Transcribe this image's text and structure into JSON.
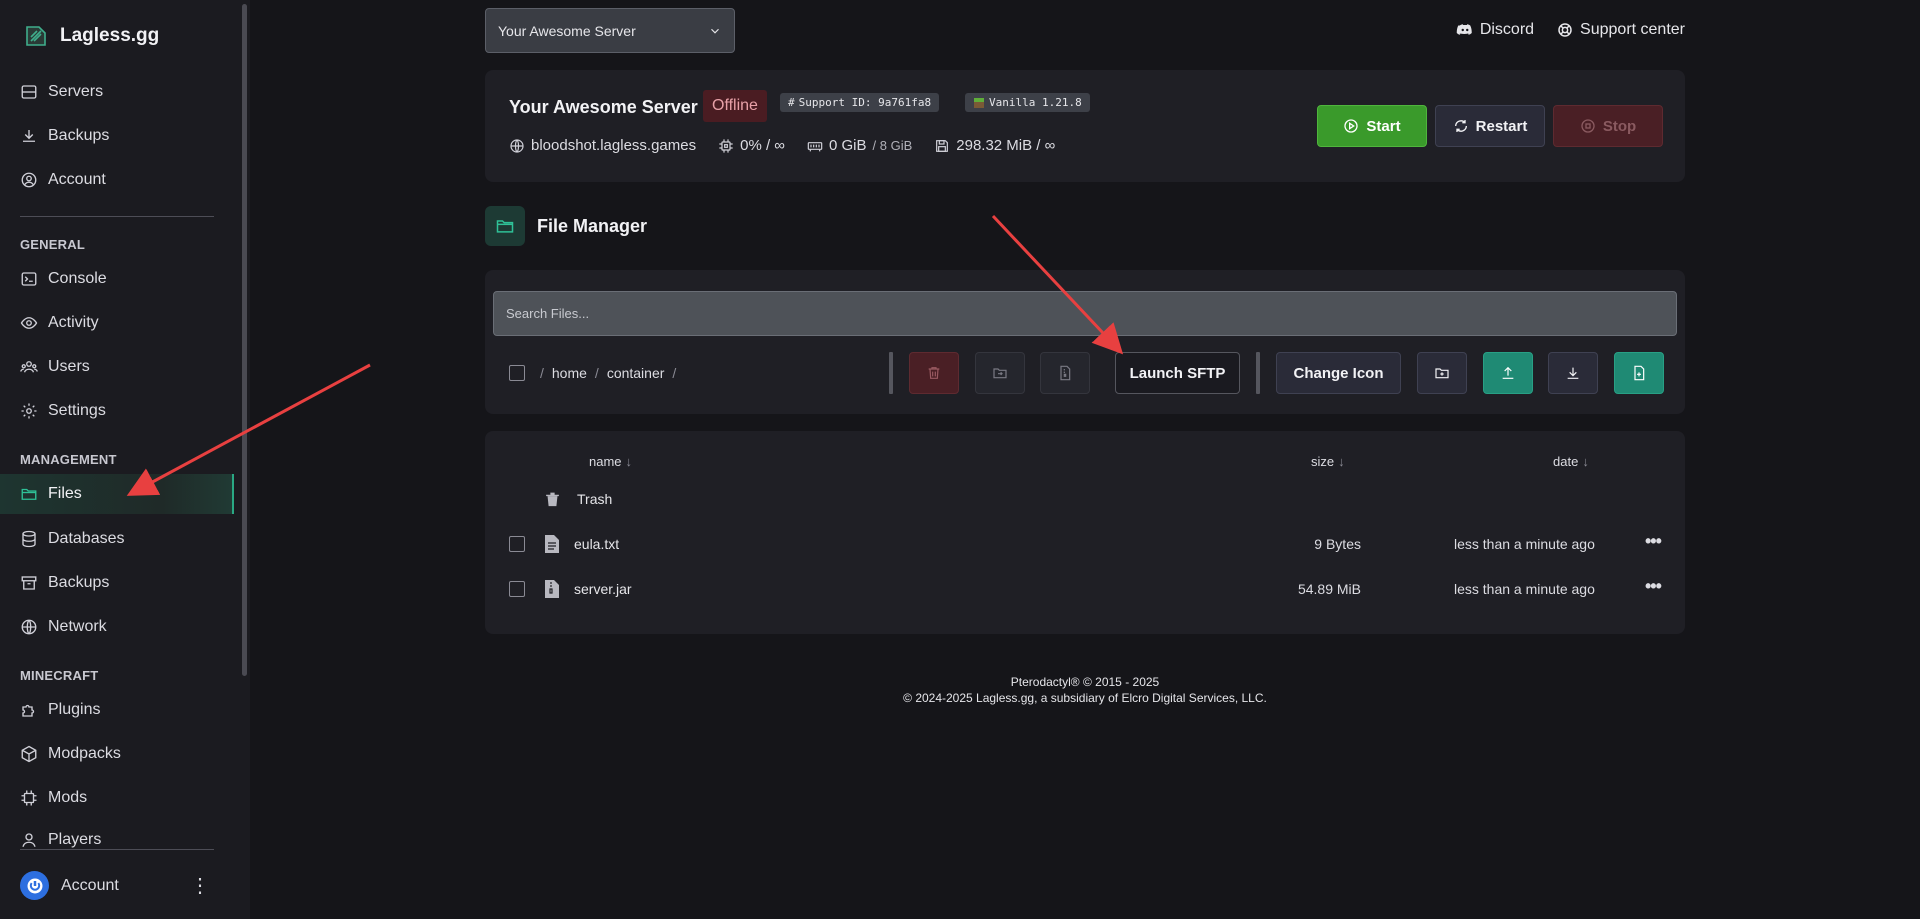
{
  "brand": {
    "name": "Lagless.gg"
  },
  "sidebar": {
    "top_items": [
      {
        "label": "Servers",
        "icon": "server-icon"
      },
      {
        "label": "Backups",
        "icon": "download-icon"
      },
      {
        "label": "Account",
        "icon": "user-circle-icon"
      }
    ],
    "sections": [
      {
        "title": "GENERAL",
        "items": [
          "Console",
          "Activity",
          "Users",
          "Settings"
        ]
      },
      {
        "title": "MANAGEMENT",
        "items": [
          "Files",
          "Databases",
          "Backups",
          "Network"
        ]
      },
      {
        "title": "MINECRAFT",
        "items": [
          "Plugins",
          "Modpacks",
          "Mods",
          "Players"
        ]
      }
    ],
    "active_item": "Files",
    "account_label": "Account"
  },
  "server_select": {
    "value": "Your Awesome Server"
  },
  "top_links": {
    "discord": "Discord",
    "support": "Support center"
  },
  "server": {
    "name": "Your Awesome Server",
    "status": "Offline",
    "support_id": "Support ID: 9a761fa8",
    "version": "Vanilla 1.21.8",
    "address": "bloodshot.lagless.games",
    "cpu": "0% / ∞",
    "memory_used": "0 GiB",
    "memory_limit": "/ 8 GiB",
    "disk": "298.32 MiB / ∞",
    "buttons": {
      "start": "Start",
      "restart": "Restart",
      "stop": "Stop"
    }
  },
  "file_manager": {
    "title": "File Manager",
    "search_placeholder": "Search Files...",
    "breadcrumb": [
      "/",
      "home",
      "/",
      "container",
      "/"
    ],
    "launch_sftp": "Launch SFTP",
    "change_icon": "Change Icon",
    "columns": {
      "name": "name",
      "size": "size",
      "date": "date",
      "sort_arrow": "↓"
    },
    "trash_label": "Trash",
    "files": [
      {
        "name": "eula.txt",
        "size": "9 Bytes",
        "date": "less than a minute ago"
      },
      {
        "name": "server.jar",
        "size": "54.89 MiB",
        "date": "less than a minute ago"
      }
    ]
  },
  "footer": {
    "line1": "Pterodactyl® © 2015 - 2025",
    "line2": "© 2024-2025 Lagless.gg, a subsidiary of Elcro Digital Services, LLC."
  },
  "colors": {
    "accent": "#2fc197",
    "start": "#3a9a2b",
    "stop": "#4a1f25",
    "annotation_arrow": "#e84040"
  }
}
